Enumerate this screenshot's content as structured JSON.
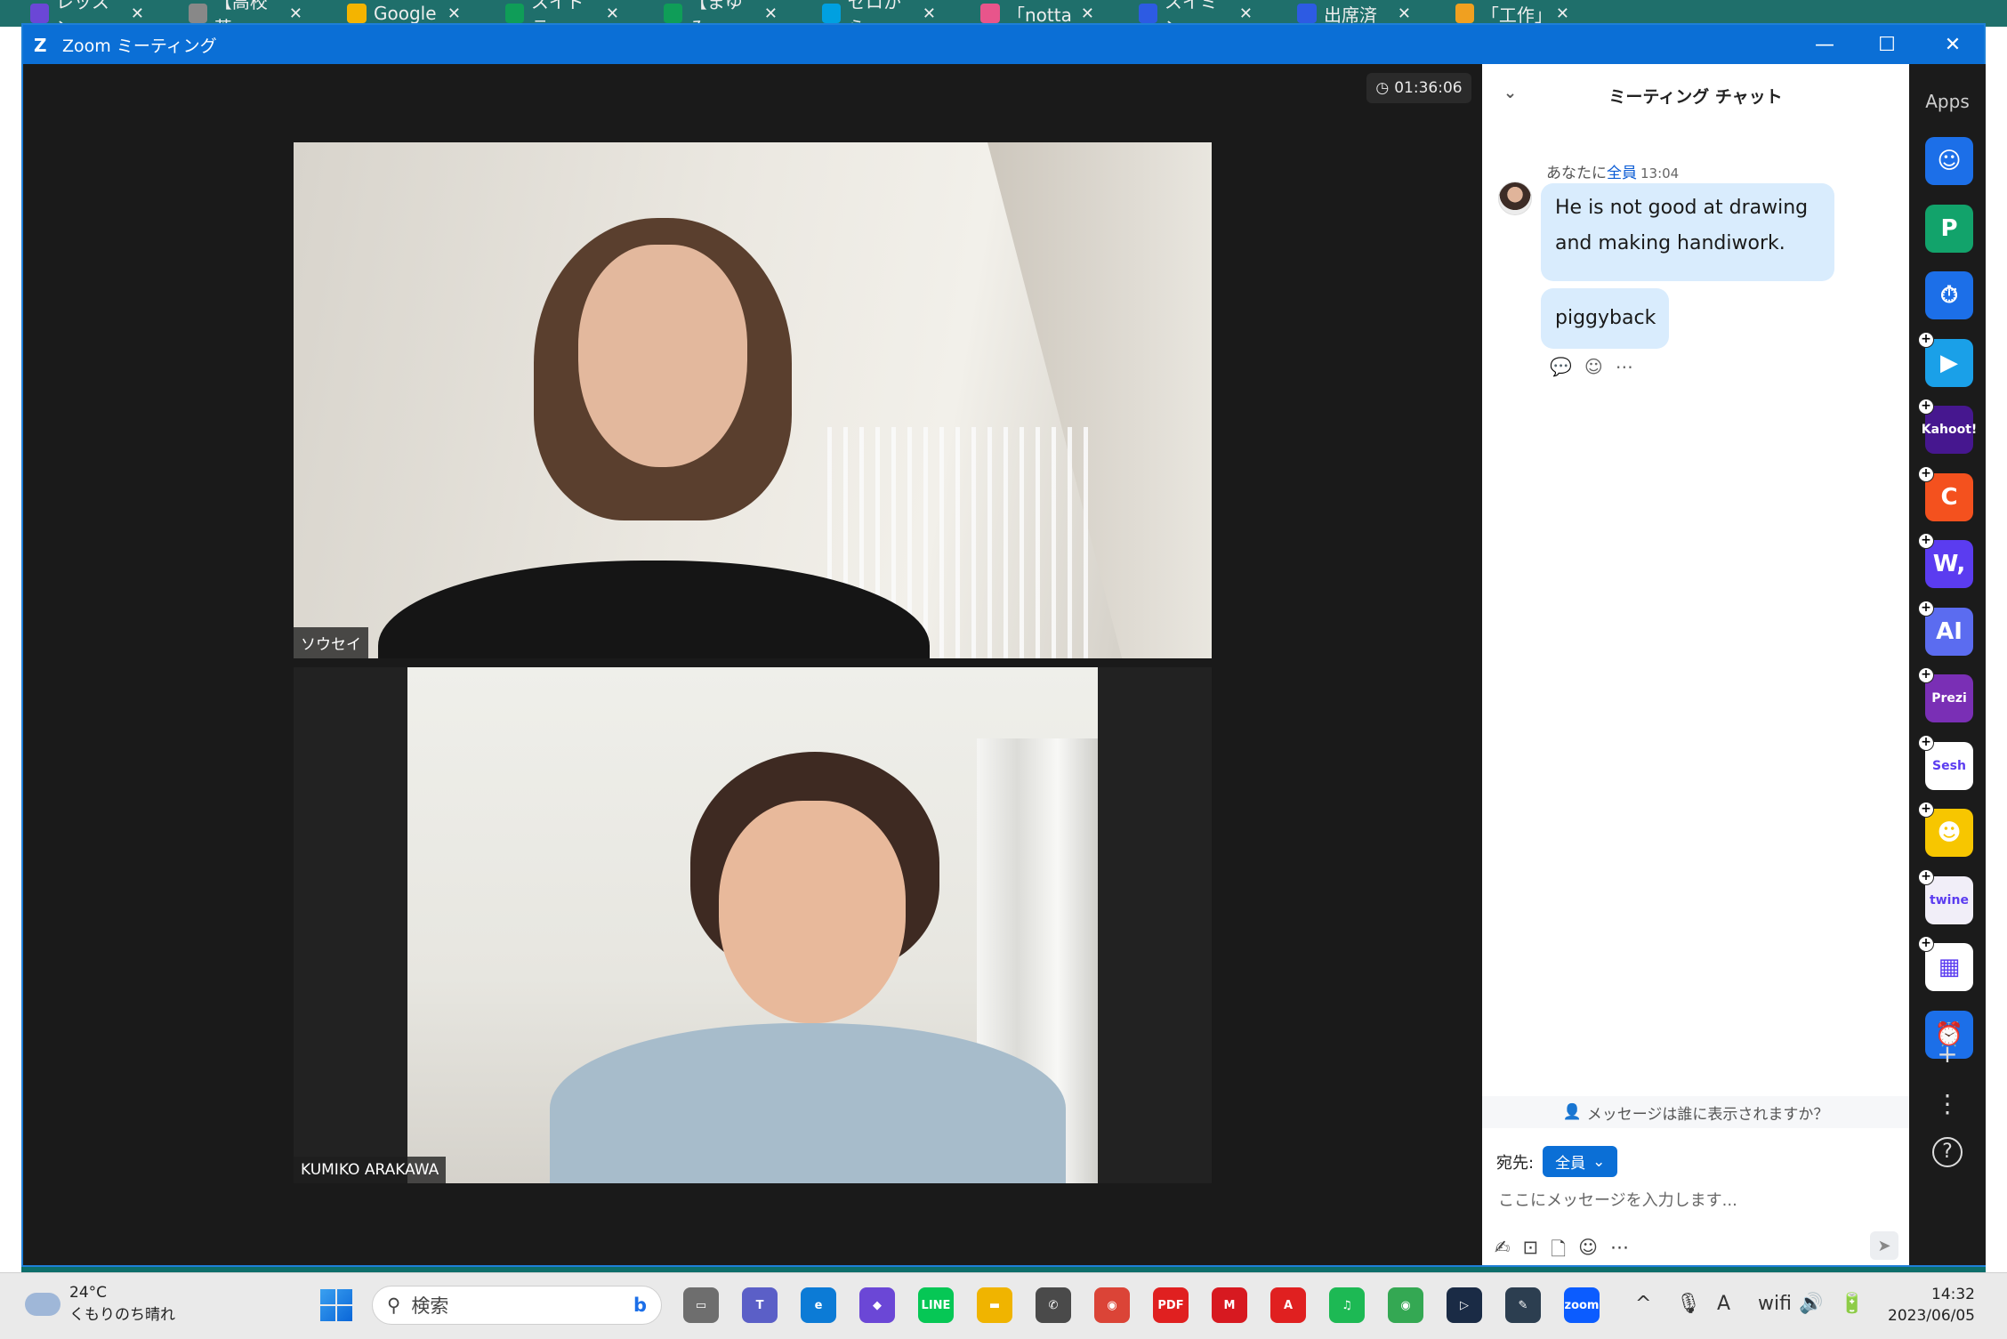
{
  "browser_tabs": [
    {
      "label": "レッスン",
      "color": "#6b47d6"
    },
    {
      "label": "【高校英",
      "color": "#888888"
    },
    {
      "label": "Google",
      "color": "#f4b400"
    },
    {
      "label": "スイドラ",
      "color": "#0f9d58"
    },
    {
      "label": "【まゆみ",
      "color": "#0f9d58"
    },
    {
      "label": "ゼロから",
      "color": "#00a0e0"
    },
    {
      "label": "「notta",
      "color": "#e8558b"
    },
    {
      "label": "スイミン",
      "color": "#2d5be3"
    },
    {
      "label": "出席済",
      "color": "#2d5be3"
    },
    {
      "label": "「工作」",
      "color": "#f0a020"
    }
  ],
  "window": {
    "title": "Zoom ミーティング",
    "minimize": "—",
    "maximize": "☐",
    "close": "✕"
  },
  "meeting": {
    "timer": "01:36:06",
    "participants": [
      {
        "name": "ソウセイ"
      },
      {
        "name": "KUMIKO ARAKAWA"
      }
    ]
  },
  "chat": {
    "title": "ミーティング チャット",
    "sender_prefix": "あなたに",
    "recipient": "全員",
    "time": "13:04",
    "messages": [
      "He is not good at drawing and making handiwork.",
      "piggyback"
    ],
    "visibility_notice": "メッセージは誰に表示されますか？",
    "to_label": "宛先:",
    "to_value": "全員",
    "input_placeholder": "ここにメッセージを入力します..."
  },
  "apps_panel": {
    "title": "Apps",
    "apps": [
      {
        "name": "smile",
        "label": "☺",
        "color": "#1c6fe8"
      },
      {
        "name": "pando",
        "label": "P",
        "color": "#12a36b"
      },
      {
        "name": "timer",
        "label": "⏱",
        "color": "#1c6fe8"
      },
      {
        "name": "flip",
        "label": "▶",
        "color": "#1aa0e8"
      },
      {
        "name": "kahoot",
        "label": "Kahoot!",
        "color": "#46178f"
      },
      {
        "name": "c",
        "label": "C",
        "color": "#f4511e"
      },
      {
        "name": "wooclap",
        "label": "W,",
        "color": "#5b3cf0"
      },
      {
        "name": "ai",
        "label": "AI",
        "color": "#5b6cf0"
      },
      {
        "name": "prezi",
        "label": "Prezi",
        "color": "#7a2fb5"
      },
      {
        "name": "sesh",
        "label": "Sesh",
        "color": "#ffffff"
      },
      {
        "name": "emoji",
        "label": "☻",
        "color": "#f7c600"
      },
      {
        "name": "twine",
        "label": "twine",
        "color": "#f1eef8"
      },
      {
        "name": "blocks",
        "label": "▦",
        "color": "#ffffff"
      },
      {
        "name": "clock",
        "label": "⏰",
        "color": "#1c6fe8"
      }
    ],
    "add": "+",
    "more": "⋮",
    "help": "?"
  },
  "taskbar": {
    "temp": "24°C",
    "weather": "くもりのち晴れ",
    "search_placeholder": "検索",
    "time": "14:32",
    "date": "2023/06/05",
    "icons": [
      {
        "name": "task-view",
        "label": "▭",
        "color": "#6e6e6e"
      },
      {
        "name": "teams",
        "label": "T",
        "color": "#5b5fc7"
      },
      {
        "name": "edge",
        "label": "e",
        "color": "#0c7bd6"
      },
      {
        "name": "copilot",
        "label": "◆",
        "color": "#6b47d6"
      },
      {
        "name": "line",
        "label": "LINE",
        "color": "#06c755"
      },
      {
        "name": "explorer",
        "label": "▬",
        "color": "#f0b400"
      },
      {
        "name": "whatsapp",
        "label": "✆",
        "color": "#4a4a4a"
      },
      {
        "name": "chrome",
        "label": "◉",
        "color": "#db4437"
      },
      {
        "name": "pdf",
        "label": "PDF",
        "color": "#e02020"
      },
      {
        "name": "mcafee",
        "label": "M",
        "color": "#d71920"
      },
      {
        "name": "acrobat",
        "label": "A",
        "color": "#e02020"
      },
      {
        "name": "spotify",
        "label": "♫",
        "color": "#1db954"
      },
      {
        "name": "chrome2",
        "label": "◉",
        "color": "#34a853"
      },
      {
        "name": "app-a",
        "label": "▷",
        "color": "#1a2b45"
      },
      {
        "name": "app-b",
        "label": "✎",
        "color": "#2c3e50"
      },
      {
        "name": "zoom",
        "label": "zoom",
        "color": "#0b5cff"
      }
    ],
    "tray": [
      "^",
      "🎙",
      "A",
      "wifi",
      "🔊",
      "🔋"
    ]
  }
}
